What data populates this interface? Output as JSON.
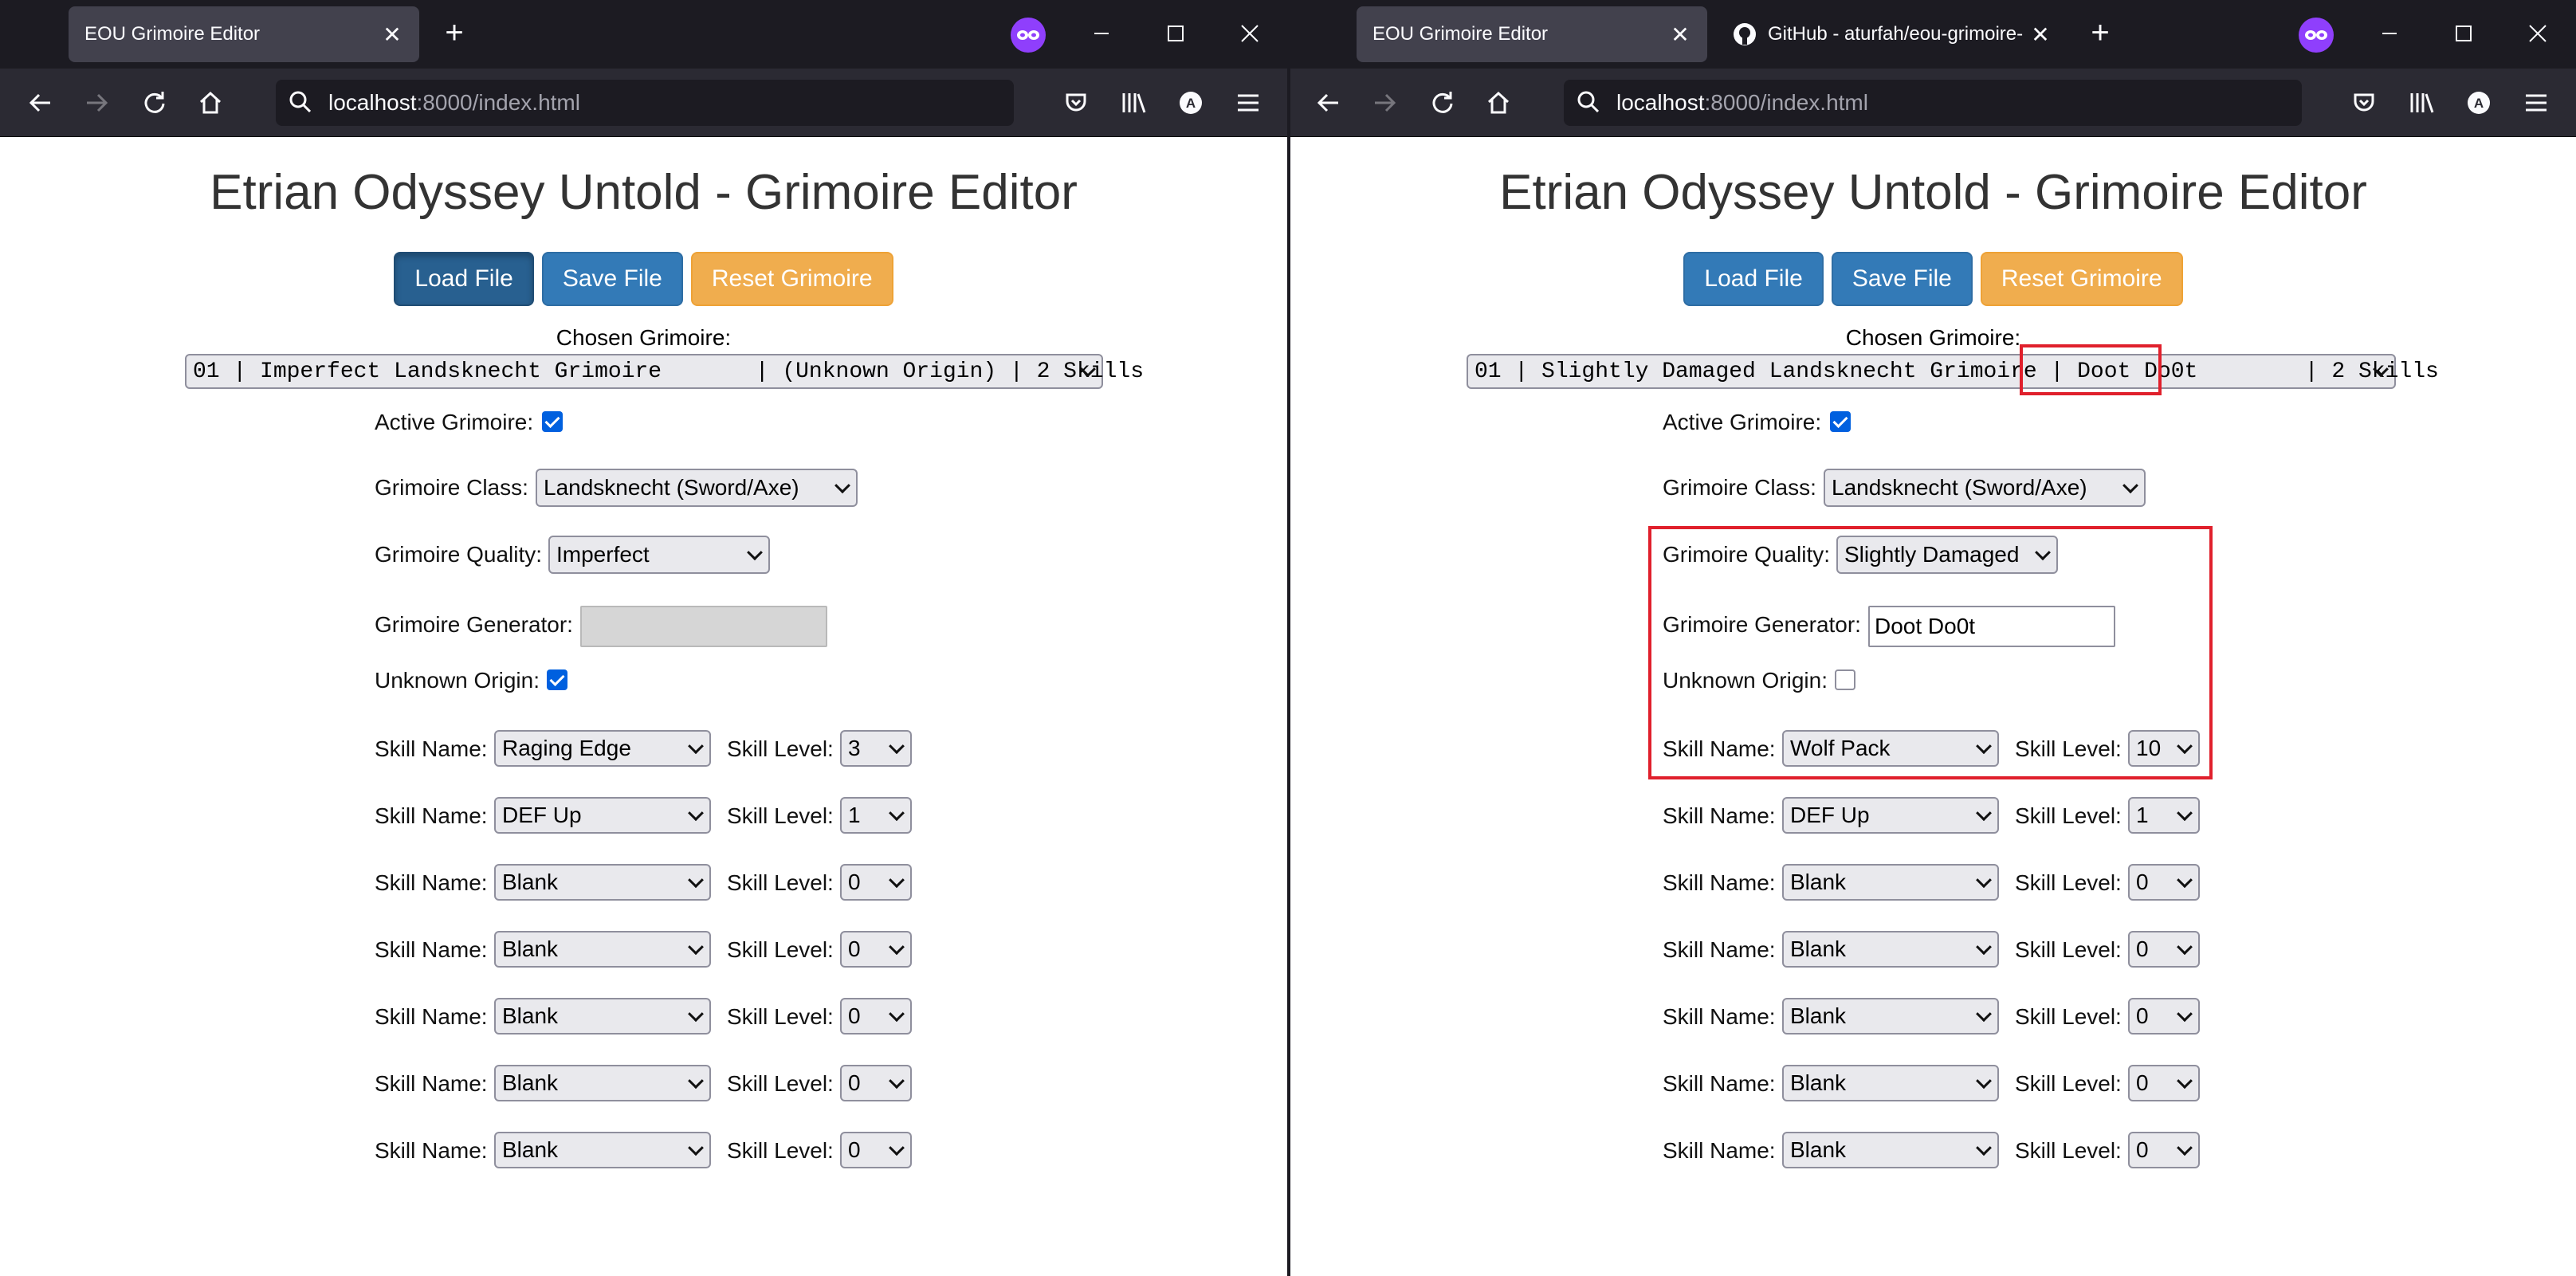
{
  "left_window": {
    "tabs": [
      {
        "title": "EOU Grimoire Editor",
        "active": true
      }
    ],
    "url": {
      "host": "localhost",
      "rest": ":8000/index.html"
    },
    "page": {
      "title": "Etrian Odyssey Untold - Grimoire Editor",
      "buttons": {
        "load": "Load File",
        "save": "Save File",
        "reset": "Reset Grimoire"
      },
      "chosen_label": "Chosen Grimoire:",
      "chosen_value": "01 | Imperfect Landsknecht Grimoire       | (Unknown Origin) | 2 Skills",
      "active_label": "Active Grimoire:",
      "active_checked": true,
      "class_label": "Grimoire Class:",
      "class_value": "Landsknecht (Sword/Axe)",
      "quality_label": "Grimoire Quality:",
      "quality_value": "Imperfect",
      "generator_label": "Grimoire Generator:",
      "generator_value": "",
      "unknown_label": "Unknown Origin:",
      "unknown_checked": true,
      "skill_name_label": "Skill Name:",
      "skill_level_label": "Skill Level:",
      "skills": [
        {
          "name": "Raging Edge",
          "level": "3"
        },
        {
          "name": "DEF Up",
          "level": "1"
        },
        {
          "name": "Blank",
          "level": "0"
        },
        {
          "name": "Blank",
          "level": "0"
        },
        {
          "name": "Blank",
          "level": "0"
        },
        {
          "name": "Blank",
          "level": "0"
        },
        {
          "name": "Blank",
          "level": "0"
        }
      ]
    }
  },
  "right_window": {
    "tabs": [
      {
        "title": "EOU Grimoire Editor",
        "active": true
      },
      {
        "title": "GitHub - aturfah/eou-grimoire-",
        "active": false
      }
    ],
    "url": {
      "host": "localhost",
      "rest": ":8000/index.html"
    },
    "page": {
      "title": "Etrian Odyssey Untold - Grimoire Editor",
      "buttons": {
        "load": "Load File",
        "save": "Save File",
        "reset": "Reset Grimoire"
      },
      "chosen_label": "Chosen Grimoire:",
      "chosen_value": "01 | Slightly Damaged Landsknecht Grimoire | Doot Do0t        | 2 Skills",
      "active_label": "Active Grimoire:",
      "active_checked": true,
      "class_label": "Grimoire Class:",
      "class_value": "Landsknecht (Sword/Axe)",
      "quality_label": "Grimoire Quality:",
      "quality_value": "Slightly Damaged",
      "generator_label": "Grimoire Generator:",
      "generator_value": "Doot Do0t",
      "unknown_label": "Unknown Origin:",
      "unknown_checked": false,
      "skill_name_label": "Skill Name:",
      "skill_level_label": "Skill Level:",
      "skills": [
        {
          "name": "Wolf Pack",
          "level": "10"
        },
        {
          "name": "DEF Up",
          "level": "1"
        },
        {
          "name": "Blank",
          "level": "0"
        },
        {
          "name": "Blank",
          "level": "0"
        },
        {
          "name": "Blank",
          "level": "0"
        },
        {
          "name": "Blank",
          "level": "0"
        },
        {
          "name": "Blank",
          "level": "0"
        }
      ]
    }
  },
  "colors": {
    "highlight": "#e0202c",
    "primary": "#337ab7",
    "warning": "#f0ad4e",
    "checkbox": "#0060df"
  },
  "icons": [
    "close-icon",
    "plus-icon",
    "private-browsing-icon",
    "minimize-icon",
    "maximize-icon",
    "window-close-icon",
    "back-icon",
    "forward-icon",
    "reload-icon",
    "home-icon",
    "search-icon",
    "pocket-icon",
    "library-icon",
    "account-icon",
    "menu-icon",
    "github-icon"
  ]
}
